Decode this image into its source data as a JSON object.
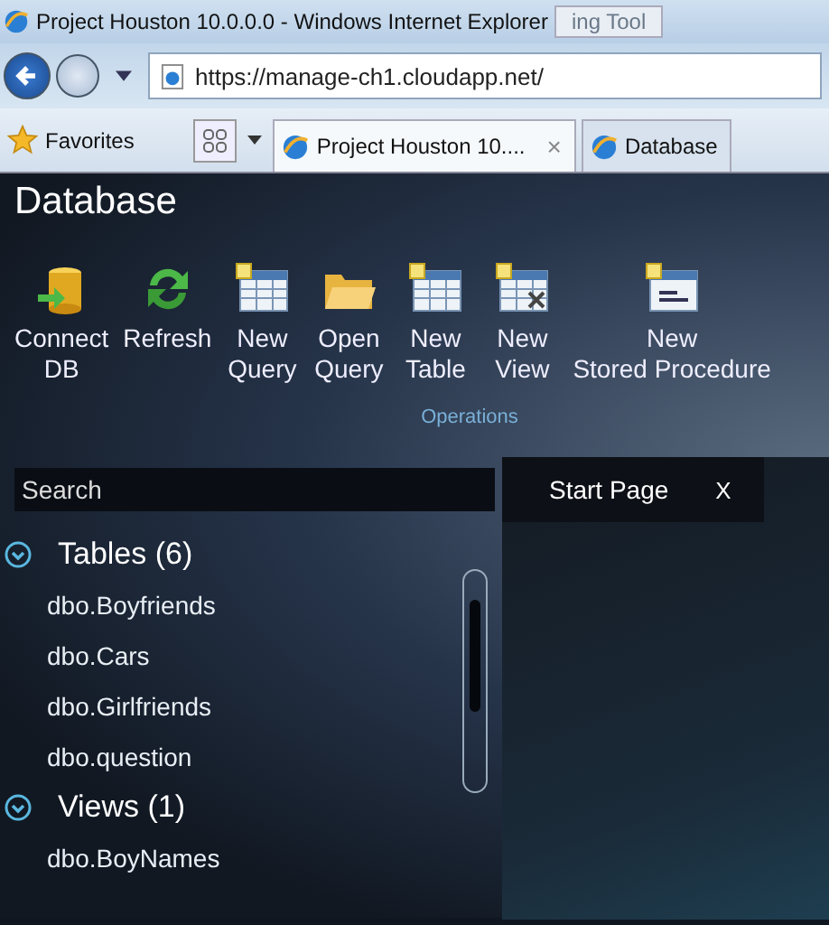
{
  "browser": {
    "title": "Project Houston 10.0.0.0 - Windows Internet Explorer",
    "overlay_fragment": "ing Tool",
    "address": "https://manage-ch1.cloudapp.net/",
    "favorites": "Favorites",
    "tabs": [
      {
        "label": "Project Houston 10....",
        "selected": true,
        "close": "×"
      },
      {
        "label": "Database",
        "selected": false
      }
    ]
  },
  "app": {
    "title": "Database",
    "toolbar": [
      {
        "kind": "db",
        "lines": [
          "Connect",
          "DB"
        ]
      },
      {
        "kind": "refresh",
        "lines": [
          "Refresh"
        ]
      },
      {
        "kind": "query",
        "lines": [
          "New",
          "Query"
        ]
      },
      {
        "kind": "folder",
        "lines": [
          "Open",
          "Query"
        ]
      },
      {
        "kind": "table",
        "lines": [
          "New",
          "Table"
        ]
      },
      {
        "kind": "view",
        "lines": [
          "New",
          "View"
        ]
      },
      {
        "kind": "proc",
        "lines": [
          "New",
          "Stored Procedure"
        ]
      }
    ],
    "group_label": "Operations",
    "search": {
      "placeholder": "Search"
    },
    "sections": [
      {
        "title": "Tables (6)",
        "expanded": true,
        "items": [
          "dbo.Boyfriends",
          "dbo.Cars",
          "dbo.Girlfriends",
          "dbo.question"
        ]
      },
      {
        "title": "Views (1)",
        "expanded": true,
        "items": [
          "dbo.BoyNames"
        ]
      }
    ],
    "doc_tab": {
      "label": "Start Page",
      "close": "X"
    }
  }
}
